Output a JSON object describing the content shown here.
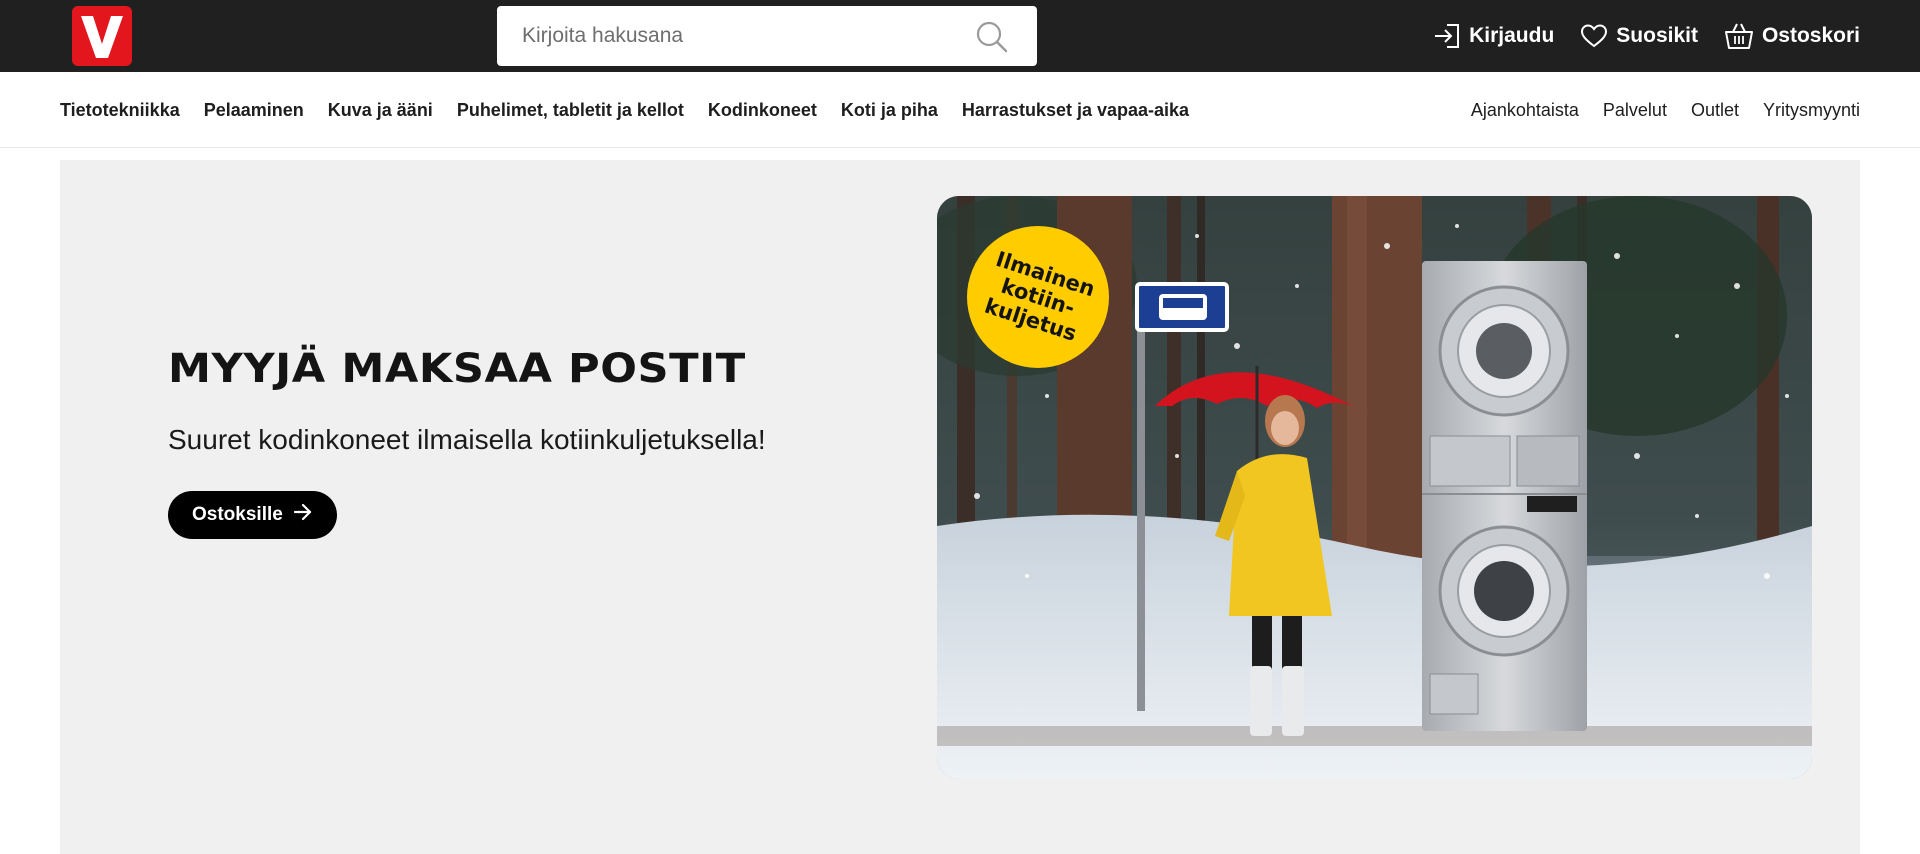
{
  "header": {
    "logo_letter": "V",
    "search_placeholder": "Kirjoita hakusana",
    "actions": {
      "login": "Kirjaudu",
      "favorites": "Suosikit",
      "cart": "Ostoskori"
    }
  },
  "nav": {
    "categories": [
      "Tietotekniikka",
      "Pelaaminen",
      "Kuva ja ääni",
      "Puhelimet, tabletit ja kellot",
      "Kodinkoneet",
      "Koti ja piha",
      "Harrastukset ja vapaa-aika"
    ],
    "secondary": [
      "Ajankohtaista",
      "Palvelut",
      "Outlet",
      "Yritysmyynti"
    ]
  },
  "hero": {
    "title": "MYYJÄ MAKSAA POSTIT",
    "subtitle": "Suuret kodinkoneet ilmaisella kotiinkuljetuksella!",
    "button_label": "Ostoksille",
    "badge_text": "Ilmainen\nkotiin-\nkuljetus"
  },
  "colors": {
    "topbar": "#202020",
    "brand_red": "#e3151d",
    "hero_bg": "#f0f0f0",
    "badge_yellow": "#ffcc00",
    "button": "#000000"
  },
  "icons": {
    "search": "search-icon",
    "login": "login-icon",
    "favorites": "heart-icon",
    "cart": "basket-icon",
    "button_arrow": "arrow-right-icon"
  }
}
